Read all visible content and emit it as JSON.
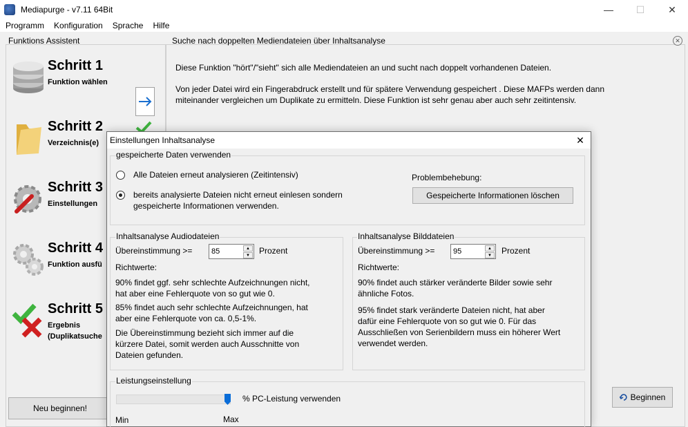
{
  "window": {
    "title": "Mediapurge - v7.11 64Bit"
  },
  "menu": {
    "items": [
      {
        "label": "Programm"
      },
      {
        "label": "Konfiguration"
      },
      {
        "label": "Sprache"
      },
      {
        "label": "Hilfe"
      }
    ]
  },
  "assistant": {
    "title": "Funktions Assistent",
    "steps": [
      {
        "title": "Schritt 1",
        "sub": "Funktion wählen",
        "icon": "database-icon"
      },
      {
        "title": "Schritt 2",
        "sub": "Verzeichnis(e)",
        "icon": "folder-icon"
      },
      {
        "title": "Schritt 3",
        "sub": "Einstellungen",
        "icon": "settings-tools-icon"
      },
      {
        "title": "Schritt 4",
        "sub": "Funktion ausfü",
        "icon": "gears-icon"
      },
      {
        "title": "Schritt 5",
        "sub": "Ergebnis\n(Duplikatsuche",
        "icon": "check-cross-icon"
      }
    ],
    "reset_label": "Neu beginnen!"
  },
  "main": {
    "title": "Suche nach doppelten Mediendateien über Inhaltsanalyse",
    "para1": "Diese Funktion \"hört\"/\"sieht\" sich alle Mediendateien an und sucht nach doppelt vorhandenen Dateien.",
    "para2": "Von jeder Datei wird ein Fingerabdruck erstellt und für spätere Verwendung gespeichert . Diese MAFPs werden dann miteinander vergleichen um Duplikate zu ermitteln. Diese Funktion ist sehr genau aber auch sehr zeitintensiv.",
    "begin_label": "Beginnen"
  },
  "dialog": {
    "title": "Einstellungen Inhaltsanalyse",
    "stored": {
      "label": "gespeicherte Daten verwenden",
      "option1": "Alle Dateien erneut analysieren (Zeitintensiv)",
      "option2_line1": "bereits analysierte Dateien nicht erneut einlesen sondern",
      "option2_line2": "gespeicherte Informationen verwenden.",
      "selected": 2,
      "trouble_label": "Problembehebung:",
      "clear_button": "Gespeicherte Informationen löschen"
    },
    "audio": {
      "label": "Inhaltsanalyse Audiodateien",
      "match_label": "Übereinstimmung >=",
      "match_value": "85",
      "unit": "Prozent",
      "hint_title": "Richtwerte:",
      "hint1_l1": "90% findet ggf. sehr schlechte Aufzeichnungen nicht,",
      "hint1_l2": "hat aber eine Fehlerquote von so gut wie 0.",
      "hint2_l1": "85% findet auch sehr schlechte Aufzeichnungen, hat",
      "hint2_l2": "aber eine Fehlerquote von ca. 0,5-1%.",
      "hint3_l1": "Die Übereinstimmung bezieht sich immer auf die",
      "hint3_l2": "kürzere Datei, somit werden auch Ausschnitte von",
      "hint3_l3": "Dateien gefunden."
    },
    "image": {
      "label": "Inhaltsanalyse Bilddateien",
      "match_label": "Übereinstimmung >=",
      "match_value": "95",
      "unit": "Prozent",
      "hint_title": "Richtwerte:",
      "hint1_l1": "90% findet auch stärker veränderte Bilder sowie sehr",
      "hint1_l2": "ähnliche Fotos.",
      "hint2_l1": "95% findet stark veränderte Dateien nicht, hat aber",
      "hint2_l2": "dafür eine  Fehlerquote von so gut wie 0. Für das",
      "hint2_l3": "Ausschließen von Serienbildern muss ein höherer Wert",
      "hint2_l4": "verwendet werden."
    },
    "performance": {
      "label": "Leistungseinstellung",
      "slider_value_fraction": 1.0,
      "slider_text": "% PC-Leistung verwenden",
      "min_label": "Min",
      "max_label": "Max"
    }
  }
}
